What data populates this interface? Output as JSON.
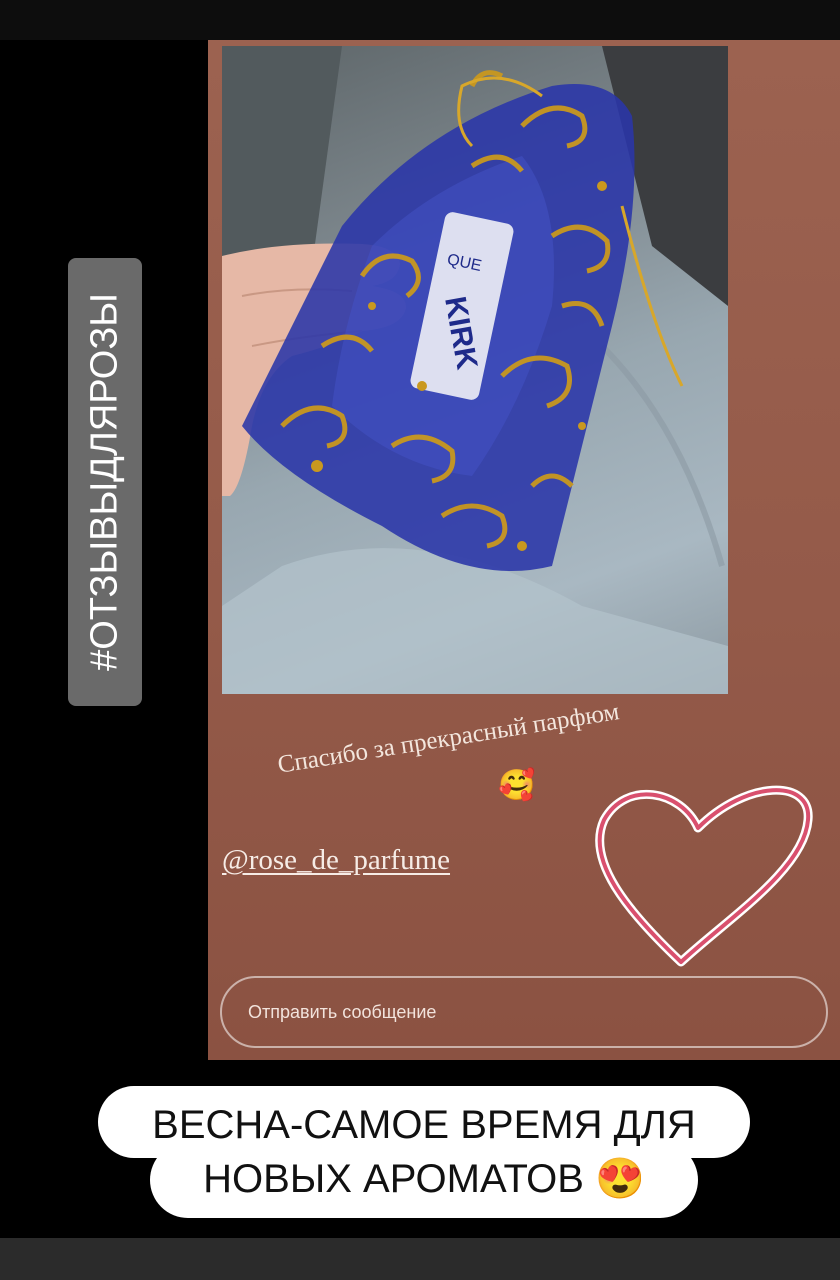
{
  "hashtag": "#ОТЗЫВЫДЛЯРОЗЫ",
  "story": {
    "thanks_text": "Спасибо за прекрасный парфюм",
    "thanks_emoji": "🥰",
    "mention": "@rose_de_parfume",
    "reply_placeholder": "Отправить сообщение",
    "bottle_label_top": "QUE",
    "bottle_label": "KIRK"
  },
  "caption": {
    "line1": "ВЕСНА-САМОЕ ВРЕМЯ ДЛЯ",
    "line2": "НОВЫХ АРОМАТОВ",
    "emoji": "😍"
  },
  "colors": {
    "story_bg": "#945a49",
    "heart": "#d9506e",
    "hashtag_bg": "#6a6a6a",
    "pouch": "#2a35a8",
    "gold": "#c9981f"
  }
}
